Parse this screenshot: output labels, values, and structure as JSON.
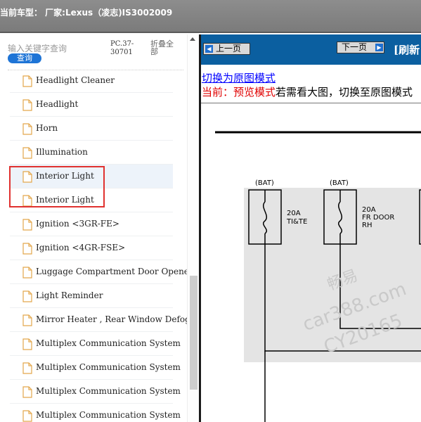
{
  "header": {
    "vehicle": "当前车型：  厂家:Lexus（凌志)IS3002009"
  },
  "search": {
    "placeholder": "输入关键字查询",
    "button": "查询",
    "code": "PC.37-30701",
    "collapse_all": "折叠全部"
  },
  "tree": {
    "items": [
      {
        "label": "Headlight Cleaner"
      },
      {
        "label": "Headlight"
      },
      {
        "label": "Horn"
      },
      {
        "label": "Illumination"
      },
      {
        "label": "Interior Light"
      },
      {
        "label": "Interior Light"
      },
      {
        "label": "Ignition <3GR-FE>"
      },
      {
        "label": "Ignition <4GR-FSE>"
      },
      {
        "label": "Luggage Compartment Door Opener"
      },
      {
        "label": "Light Reminder"
      },
      {
        "label": "Mirror Heater , Rear Window Defogger"
      },
      {
        "label": "Multiplex Communication System"
      },
      {
        "label": "Multiplex Communication System"
      },
      {
        "label": "Multiplex Communication System"
      },
      {
        "label": "Multiplex Communication System"
      }
    ]
  },
  "nav": {
    "prev": "上一页",
    "next": "下一页",
    "refresh": "[刷新"
  },
  "view": {
    "switch_link": "切换为原图模式",
    "mode_current": "当前：预览模式",
    "mode_hint": "若需看大图，切换至原图模式"
  },
  "diagram": {
    "fuse1_source": "(BAT)",
    "fuse1_rating": "20A",
    "fuse1_name": "TI&TE",
    "fuse2_source": "(BAT)",
    "fuse2_rating": "20A",
    "fuse2_name_1": "FR DOOR",
    "fuse2_name_2": "RH"
  },
  "watermark": {
    "line1": "畅易",
    "line2": "car388.com",
    "line3": "CY20165"
  },
  "colors": {
    "nav_bg": "#0b5fa0",
    "link": "#0000ff",
    "highlight_box": "#e0312f",
    "mode_red": "#e00000",
    "query_button": "#1e74d6"
  }
}
